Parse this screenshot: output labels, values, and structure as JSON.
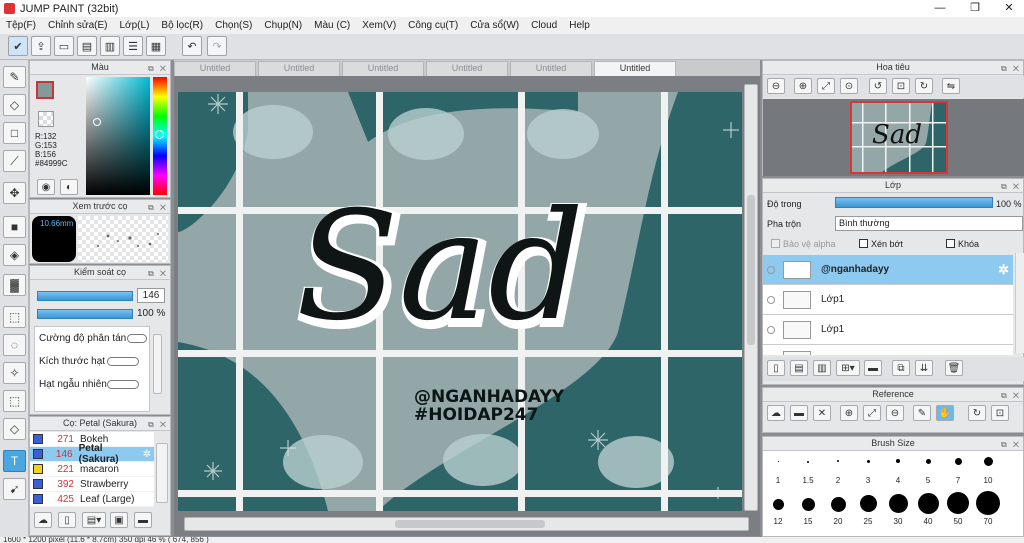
{
  "window": {
    "title": "JUMP PAINT (32bit)",
    "minimize": "—",
    "restore": "❐",
    "close": "✕"
  },
  "menu": [
    "Tệp(F)",
    "Chỉnh sửa(E)",
    "Lớp(L)",
    "Bộ lọc(R)",
    "Chọn(S)",
    "Chụp(N)",
    "Màu (C)",
    "Xem(V)",
    "Công cụ(T)",
    "Cửa sổ(W)",
    "Cloud",
    "Help"
  ],
  "toolbar": {
    "undo": "↶",
    "redo": "↷"
  },
  "color_panel": {
    "title": "Màu",
    "r": "R:132",
    "g": "G:153",
    "b": "B:156",
    "hex": "#84999C",
    "current_color": "#84999C"
  },
  "brush_preview": {
    "title": "Xem trước cọ",
    "size": "10.66mm"
  },
  "brush_control": {
    "title": "Kiểm soát cọ",
    "value1": "146",
    "value2": "100 %",
    "params": [
      "Cường độ phân tán",
      "Kích thước hạt",
      "Hạt ngẫu nhiên"
    ]
  },
  "brush_list": {
    "title": "Cọ: Petal (Sakura)",
    "items": [
      {
        "num": "271",
        "name": "Bokeh",
        "color": "#3a5fd6"
      },
      {
        "num": "146",
        "name": "Petal (Sakura)",
        "color": "#3a5fd6"
      },
      {
        "num": "221",
        "name": "macaron",
        "color": "#f2d21a"
      },
      {
        "num": "392",
        "name": "Strawberry",
        "color": "#3a5fd6"
      },
      {
        "num": "425",
        "name": "Leaf (Large)",
        "color": "#3a5fd6"
      }
    ]
  },
  "tabs": [
    "Untitled",
    "Untitled",
    "Untitled",
    "Untitled",
    "Untitled",
    "Untitled"
  ],
  "artwork": {
    "main_text": "Sad",
    "handle": "@NGANHADAYY",
    "hashtag": "#HOIDAP247"
  },
  "navigator": {
    "title": "Hoa tiêu",
    "thumb_text": "Sad"
  },
  "layers": {
    "title": "Lớp",
    "opacity_label": "Độ trong",
    "opacity_value": "100 %",
    "blend_label": "Pha trộn",
    "blend_value": "Bình thường",
    "protect_alpha": "Bảo vệ alpha",
    "clip": "Xén bớt",
    "lock": "Khóa",
    "items": [
      "@nganhadayy",
      "Lớp1",
      "Lớp1"
    ]
  },
  "reference": {
    "title": "Reference"
  },
  "brush_size": {
    "title": "Brush Size",
    "row1": [
      "1",
      "1.5",
      "2",
      "3",
      "4",
      "5",
      "7",
      "10"
    ],
    "row2": [
      "12",
      "15",
      "20",
      "25",
      "30",
      "40",
      "50",
      "70"
    ]
  },
  "status": "1600 * 1200 pixel   (11.6 * 8.7cm)   350 dpi   46 %   ( 674, 856 )"
}
